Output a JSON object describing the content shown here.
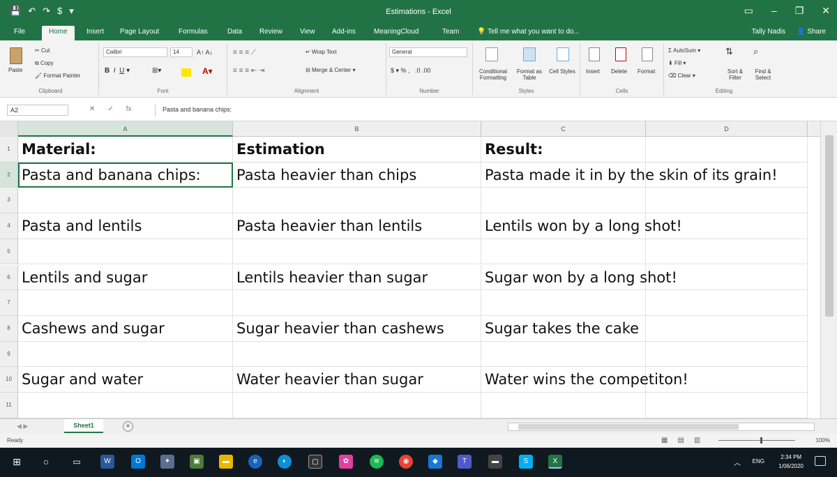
{
  "window": {
    "title": "Estimations - Excel",
    "quick_access": [
      "💾",
      "↶",
      "↷",
      "$",
      "▾"
    ],
    "controls": [
      "▭",
      "–",
      "❐",
      "✕"
    ]
  },
  "tabs": [
    "File",
    "Home",
    "Insert",
    "Page Layout",
    "Formulas",
    "Data",
    "Review",
    "View",
    "Add-ins",
    "MeaningCloud",
    "Team"
  ],
  "active_tab": "Home",
  "tell_me": "Tell me what you want to do...",
  "user": "Tally Nadis",
  "share": "Share",
  "ribbon": {
    "clipboard": {
      "label": "Clipboard",
      "paste": "Paste",
      "cut": "Cut",
      "copy": "Copy",
      "format_painter": "Format Painter"
    },
    "font": {
      "label": "Font",
      "font_name": "Calibri",
      "font_size": "14"
    },
    "alignment": {
      "label": "Alignment",
      "wrap_text": "Wrap Text",
      "merge_center": "Merge & Center"
    },
    "number": {
      "label": "Number",
      "format": "General"
    },
    "styles": {
      "label": "Styles",
      "conditional": "Conditional Formatting",
      "format_table": "Format as Table",
      "cell_styles": "Cell Styles"
    },
    "cells": {
      "label": "Cells",
      "insert": "Insert",
      "delete": "Delete",
      "format": "Format"
    },
    "editing": {
      "label": "Editing",
      "autosum": "AutoSum",
      "fill": "Fill",
      "clear": "Clear",
      "sort_filter": "Sort & Filter",
      "find_select": "Find & Select"
    }
  },
  "formula_bar": {
    "name_box": "A2",
    "fx": "fx",
    "content": "Pasta and banana chips:"
  },
  "columns": [
    "A",
    "B",
    "C",
    "D"
  ],
  "active_cell": "A2",
  "rows": [
    {
      "num": "1",
      "cells": [
        "Material:",
        "Estimation",
        "Result:"
      ],
      "bold": true
    },
    {
      "num": "2",
      "cells": [
        "Pasta and banana chips:",
        "Pasta heavier than chips",
        "Pasta made it in by the skin of its grain!"
      ]
    },
    {
      "num": "3",
      "cells": [
        "",
        "",
        ""
      ]
    },
    {
      "num": "4",
      "cells": [
        "Pasta and lentils",
        "Pasta heavier than lentils",
        "Lentils won by a long shot!"
      ]
    },
    {
      "num": "5",
      "cells": [
        "",
        "",
        ""
      ]
    },
    {
      "num": "6",
      "cells": [
        "Lentils and sugar",
        "Lentils heavier than sugar",
        "Sugar won by a long shot!"
      ]
    },
    {
      "num": "7",
      "cells": [
        "",
        "",
        ""
      ]
    },
    {
      "num": "8",
      "cells": [
        "Cashews and sugar",
        "Sugar heavier than cashews",
        "Sugar takes the cake"
      ]
    },
    {
      "num": "9",
      "cells": [
        "",
        "",
        ""
      ]
    },
    {
      "num": "10",
      "cells": [
        "Sugar and water",
        "Water heavier than sugar",
        "Water wins the competiton!"
      ]
    },
    {
      "num": "11",
      "cells": [
        "",
        "",
        ""
      ]
    }
  ],
  "sheet_tab": "Sheet1",
  "status": {
    "ready": "Ready",
    "zoom": "100%"
  },
  "taskbar": {
    "time": "2:34 PM",
    "date": "1/06/2020",
    "lang": "ENG"
  },
  "colors": {
    "excel_green": "#217346",
    "taskbar": "#101820"
  }
}
